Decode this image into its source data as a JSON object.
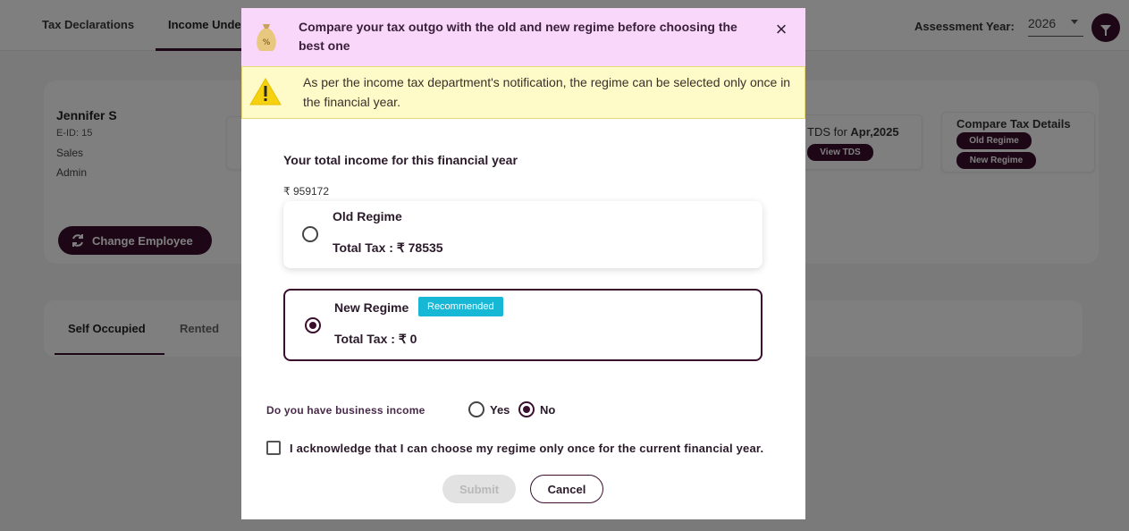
{
  "background": {
    "tabs": [
      "Tax Declarations",
      "Income Unde"
    ],
    "assessment_year_label": "Assessment Year:",
    "assessment_year_value": "2026",
    "employee": {
      "name": "Jennifer S",
      "id": "E-ID: 15",
      "department": "Sales",
      "role": "Admin",
      "change_button": "Change Employee"
    },
    "tds": {
      "prefix": "TDS for ",
      "month": "Apr,2025",
      "button": "View TDS"
    },
    "compare": {
      "title": "Compare Tax Details",
      "old_button": "Old Regime",
      "new_button": "New Regime"
    },
    "occupancy_tabs": [
      "Self Occupied",
      "Rented"
    ]
  },
  "modal": {
    "title": "Compare your tax outgo with the old and new regime before choosing the best one",
    "warning": "As per the income tax department's notification, the regime can be selected only once in the financial year.",
    "income_label": "Your total income for this financial year",
    "income_value": "₹ 959172",
    "old_regime": {
      "name": "Old Regime",
      "tax": "Total Tax : ₹ 78535",
      "selected": false
    },
    "new_regime": {
      "name": "New Regime",
      "badge": "Recommended",
      "tax": "Total Tax : ₹ 0",
      "selected": true
    },
    "business_question": "Do you have business income",
    "business_yes": "Yes",
    "business_no": "No",
    "business_selected": "No",
    "acknowledge": "I acknowledge that I can choose my regime only once for the current financial year.",
    "submit": "Submit",
    "cancel": "Cancel"
  },
  "colors": {
    "brand": "#3a0f2e",
    "header_bg": "#f8d7fb",
    "warning_bg": "#fffbc8",
    "badge": "#17b8d6"
  }
}
